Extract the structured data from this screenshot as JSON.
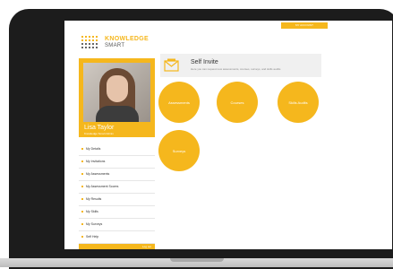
{
  "header": {
    "top_button_label": "MY ACCOUNT",
    "logo_line1": "KNOWLEDGE",
    "logo_line2": "SMART"
  },
  "profile": {
    "name": "Lisa Taylor",
    "role": "Knowledge Smart Admin"
  },
  "menu": {
    "items": [
      {
        "label": "My Details"
      },
      {
        "label": "My Invitations"
      },
      {
        "label": "My Assessments"
      },
      {
        "label": "My Assessment Scores"
      },
      {
        "label": "My Results"
      },
      {
        "label": "My Skills"
      },
      {
        "label": "My Surveys"
      },
      {
        "label": "Self Help"
      }
    ],
    "footer_label": "Log out"
  },
  "invite": {
    "title": "Self Invite",
    "description": "Here you can request new assessments, courses, surveys, and skills audits"
  },
  "options": [
    {
      "label": "Assessments"
    },
    {
      "label": "Courses"
    },
    {
      "label": "Skills Audits"
    },
    {
      "label": "Surveys"
    }
  ],
  "colors": {
    "accent": "#f5b71d",
    "bezel": "#1c1c1c"
  }
}
